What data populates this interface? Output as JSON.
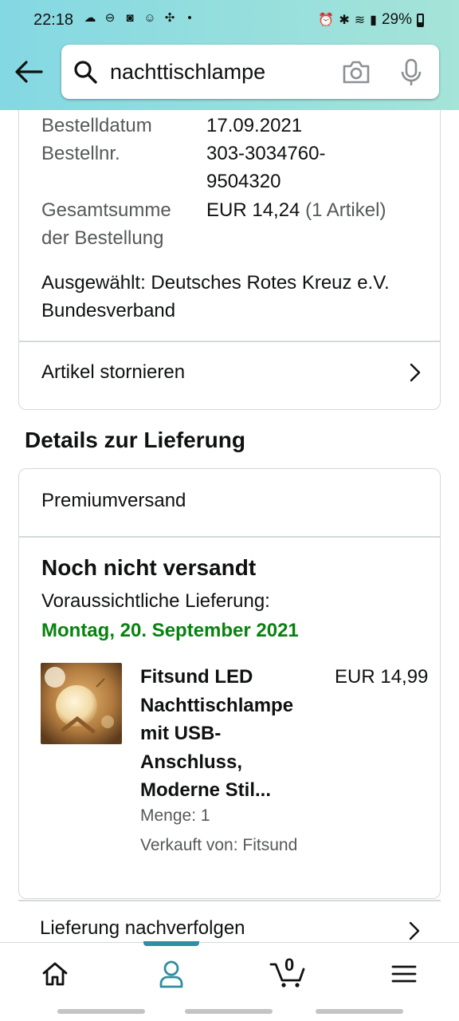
{
  "status_bar": {
    "time": "22:18",
    "battery": "29%"
  },
  "search": {
    "query": "nachttischlampe"
  },
  "order": {
    "date_label": "Bestelldatum",
    "date_value": "17.09.2021",
    "number_label": "Bestellnr.",
    "number_value_line1": "303-3034760-",
    "number_value_line2": "9504320",
    "total_label_line1": "Gesamtsumme",
    "total_label_line2": "der Bestellung",
    "total_value": "EUR 14,24",
    "total_items": "(1 Artikel)",
    "selected_line1": "Ausgewählt: Deutsches Rotes Kreuz e.V.",
    "selected_line2": "Bundesverband",
    "cancel_label": "Artikel stornieren"
  },
  "delivery": {
    "section_title": "Details zur Lieferung",
    "shipping_type": "Premiumversand",
    "status": "Noch nicht versandt",
    "eta_label": "Voraussichtliche Lieferung:",
    "eta_date": "Montag, 20. September 2021",
    "product": {
      "title_lines": [
        "Fitsund LED",
        "Nachttischlampe",
        "mit USB-",
        "Anschluss,",
        "Moderne Stil..."
      ],
      "price": "EUR 14,99",
      "quantity": "Menge: 1",
      "seller": "Verkauft von: Fitsund"
    },
    "track_label": "Lieferung nachverfolgen"
  },
  "bottom_nav": {
    "active": "account",
    "cart_count": "0",
    "accent_color": "#2e8fa0"
  },
  "colors": {
    "header_gradient_start": "#84d8e3",
    "header_gradient_end": "#a5e4d8",
    "eta_green": "#08820f",
    "muted_text": "#565959"
  }
}
